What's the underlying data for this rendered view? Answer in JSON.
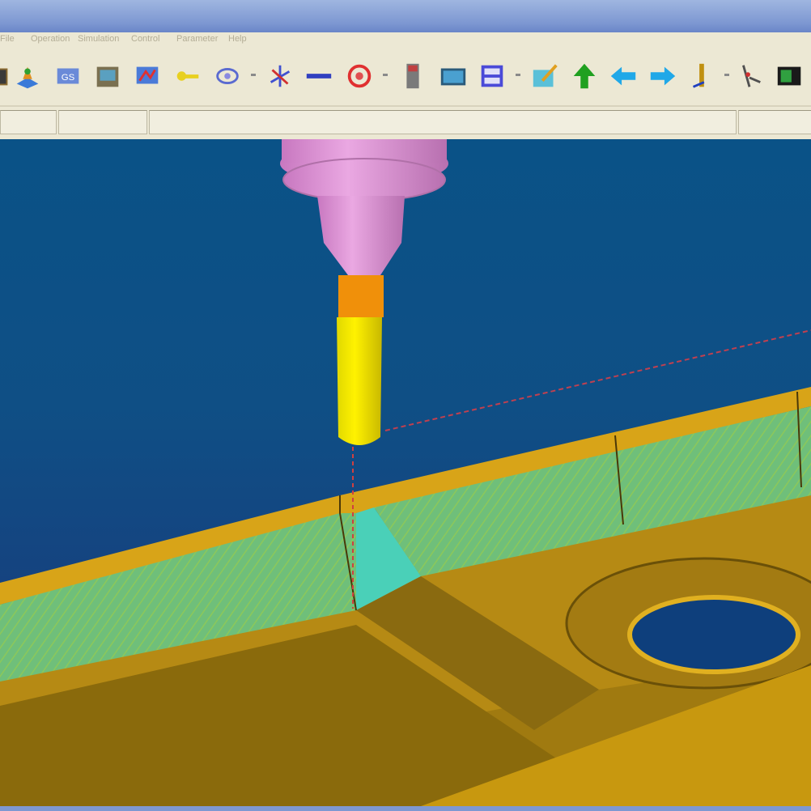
{
  "window": {
    "title": ""
  },
  "menu": {
    "items": [
      "File",
      "Operation",
      "Simulation",
      "Control",
      "Parameter",
      "Help"
    ]
  },
  "toolbar": {
    "buttons": [
      {
        "icon": "open-part-icon"
      },
      {
        "icon": "stock-icon"
      },
      {
        "icon": "workpiece-icon"
      },
      {
        "icon": "fixture-icon"
      },
      {
        "icon": "tool-path-icon"
      },
      {
        "icon": "key-icon"
      },
      {
        "icon": "measure-icon"
      },
      {
        "icon": "axis-icon"
      },
      {
        "icon": "line-icon"
      },
      {
        "icon": "cycle-icon"
      },
      {
        "icon": "tool-icon"
      },
      {
        "icon": "monitor-icon"
      },
      {
        "icon": "save-view-icon"
      },
      {
        "icon": "edit-icon"
      },
      {
        "icon": "up-arrow-icon"
      },
      {
        "icon": "back-arrow-icon"
      },
      {
        "icon": "forward-arrow-icon"
      },
      {
        "icon": "step-icon"
      },
      {
        "icon": "compass-icon"
      },
      {
        "icon": "exit-icon"
      }
    ]
  },
  "status": {
    "fields": [
      "",
      "",
      "",
      ""
    ]
  },
  "colors": {
    "spindle": "#d88fd0",
    "tool_holder": "#f0900a",
    "tool": "#f5f000",
    "part": "#c09010",
    "part_top": "#d8a418",
    "machined": "#6fbf7a",
    "viewport_top": "#0a5287",
    "viewport_bottom": "#21307a"
  }
}
